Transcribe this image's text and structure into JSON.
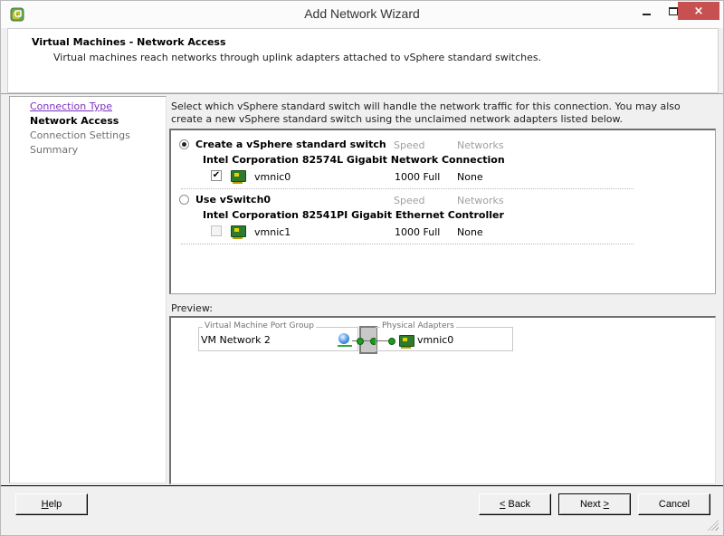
{
  "window": {
    "title": "Add Network Wizard",
    "controls": {
      "minimize": "minimize",
      "maximize": "maximize",
      "close": "×"
    }
  },
  "header": {
    "title": "Virtual Machines - Network Access",
    "subtitle": "Virtual machines reach networks through uplink adapters attached to vSphere standard switches."
  },
  "steps": [
    {
      "label": "Connection Type",
      "state": "visited"
    },
    {
      "label": "Network Access",
      "state": "current"
    },
    {
      "label": "Connection Settings",
      "state": "future"
    },
    {
      "label": "Summary",
      "state": "future"
    }
  ],
  "instructions": "Select which vSphere standard switch will handle the network traffic for this connection. You may also create a new vSphere standard switch using the unclaimed network adapters listed below.",
  "options": [
    {
      "label": "Create a vSphere standard switch",
      "selected": true,
      "col_speed": "Speed",
      "col_networks": "Networks",
      "adapter_name": "Intel Corporation 82574L Gigabit Network Connection",
      "nic": {
        "name": "vmnic0",
        "checked": true,
        "check_glyph": "✔",
        "speed": "1000 Full",
        "networks": "None"
      }
    },
    {
      "label": "Use vSwitch0",
      "selected": false,
      "col_speed": "Speed",
      "col_networks": "Networks",
      "adapter_name": "Intel Corporation 82541PI Gigabit Ethernet Controller",
      "nic": {
        "name": "vmnic1",
        "checked": false,
        "check_glyph": "",
        "speed": "1000 Full",
        "networks": "None"
      }
    }
  ],
  "preview": {
    "label": "Preview:",
    "port_group_title": "Virtual Machine Port Group",
    "port_group_name": "VM Network 2",
    "physical_title": "Physical Adapters",
    "physical_nic": "vmnic0"
  },
  "buttons": {
    "help": {
      "mnemonic": "H",
      "rest": "elp"
    },
    "back": {
      "mnemonic": "<",
      "rest": " Back"
    },
    "next": {
      "prefix": "Next ",
      "mnemonic": ">"
    },
    "cancel": "Cancel"
  },
  "colors": {
    "close_button": "#c75050",
    "visited_link": "#7b2fbe",
    "nic_green": "#2f7a2f",
    "connector_green": "#1e9a1e"
  }
}
